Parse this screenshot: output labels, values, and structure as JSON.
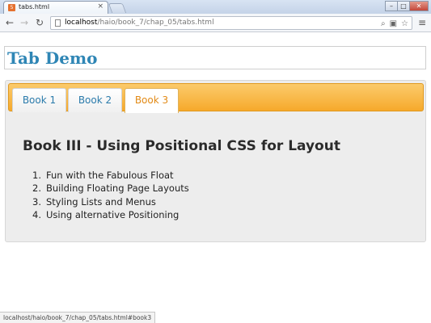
{
  "browser": {
    "tab_title": "tabs.html",
    "url_host": "localhost",
    "url_path": "/haio/book_7/chap_05/tabs.html",
    "status_url": "localhost/haio/book_7/chap_05/tabs.html#book3"
  },
  "page": {
    "title": "Tab Demo",
    "tabs": [
      {
        "label": "Book 1",
        "selected": false
      },
      {
        "label": "Book 2",
        "selected": false
      },
      {
        "label": "Book 3",
        "selected": true
      }
    ],
    "active_content": {
      "heading": "Book III - Using Positional CSS for Layout",
      "items": [
        {
          "num": "1.",
          "text": "Fun with the Fabulous Float"
        },
        {
          "num": "2.",
          "text": "Building Floating Page Layouts"
        },
        {
          "num": "3.",
          "text": "Styling Lists and Menus"
        },
        {
          "num": "4.",
          "text": "Using alternative Positioning"
        }
      ]
    }
  },
  "colors": {
    "title": "#2f86b5",
    "tab_bar": "#f6a92b",
    "active_tab_text": "#e28a16",
    "inactive_tab_text": "#2b7bab",
    "panel_bg": "#ededed"
  },
  "icons": {
    "back": "back-arrow-icon",
    "forward": "forward-arrow-icon",
    "reload": "reload-icon",
    "page": "page-icon",
    "search": "search-icon",
    "bookmark": "star-icon",
    "menu": "menu-icon"
  }
}
